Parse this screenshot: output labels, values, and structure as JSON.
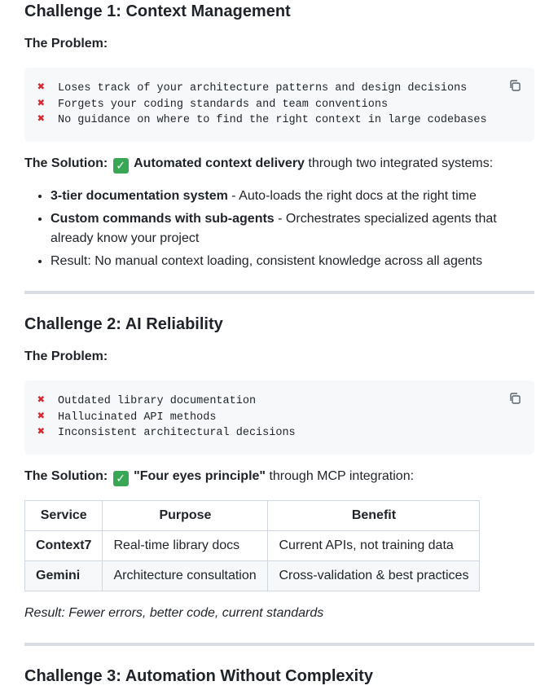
{
  "challenge1": {
    "title": "Challenge 1: Context Management",
    "problem_label": "The Problem:",
    "problems": [
      "Loses track of your architecture patterns and design decisions",
      "Forgets your coding standards and team conventions",
      "No guidance on where to find the right context in large codebases"
    ],
    "solution_label": "The Solution:",
    "solution_bold": "Automated context delivery",
    "solution_rest": " through two integrated systems:",
    "bullets": [
      {
        "bold": "3-tier documentation system",
        "rest": " - Auto-loads the right docs at the right time"
      },
      {
        "bold": "Custom commands with sub-agents",
        "rest": " - Orchestrates specialized agents that already know your project"
      },
      {
        "bold": "",
        "rest": "Result: No manual context loading, consistent knowledge across all agents"
      }
    ]
  },
  "challenge2": {
    "title": "Challenge 2: AI Reliability",
    "problem_label": "The Problem:",
    "problems": [
      "Outdated library documentation",
      "Hallucinated API methods",
      "Inconsistent architectural decisions"
    ],
    "solution_label": "The Solution:",
    "solution_bold": "\"Four eyes principle\"",
    "solution_rest": " through MCP integration:",
    "table": {
      "headers": [
        "Service",
        "Purpose",
        "Benefit"
      ],
      "rows": [
        [
          "Context7",
          "Real-time library docs",
          "Current APIs, not training data"
        ],
        [
          "Gemini",
          "Architecture consultation",
          "Cross-validation & best practices"
        ]
      ]
    },
    "result": "Result: Fewer errors, better code, current standards"
  },
  "challenge3": {
    "title": "Challenge 3: Automation Without Complexity"
  },
  "icons": {
    "cross": "cross-mark-icon",
    "check": "check-mark-icon",
    "copy": "copy-icon"
  },
  "colors": {
    "code_bg": "#f6f8fa",
    "cross": "#d9262e",
    "check": "#3aa757",
    "rule": "#d8dee4"
  }
}
